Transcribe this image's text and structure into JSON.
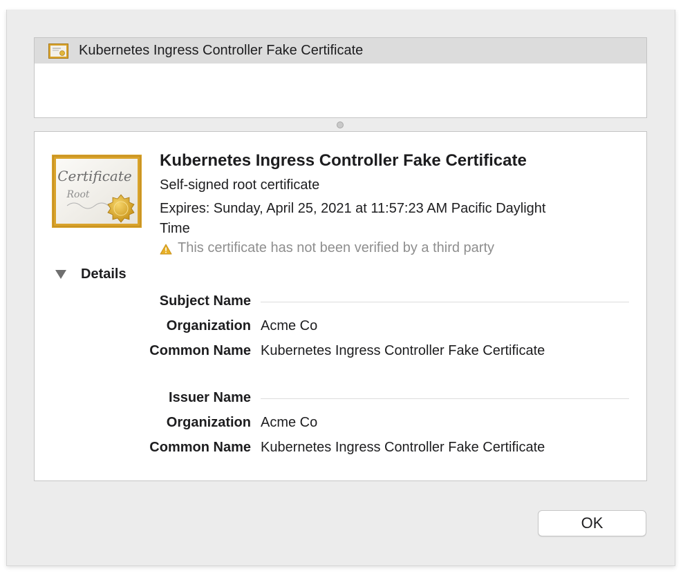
{
  "certificate_list": {
    "items": [
      {
        "icon": "certificate-icon",
        "label": "Kubernetes Ingress Controller Fake Certificate",
        "selected": true
      }
    ]
  },
  "certificate": {
    "icon": "certificate-root-icon",
    "title": "Kubernetes Ingress Controller Fake Certificate",
    "subtitle": "Self-signed root certificate",
    "expires": "Expires: Sunday, April 25, 2021 at 11:57:23 AM Pacific Daylight Time",
    "warning": "This certificate has not been verified by a third party",
    "warning_icon": "warning-icon",
    "icon_text": {
      "line1": "Certificate",
      "line2": "Root"
    }
  },
  "details": {
    "label": "Details",
    "expanded": true,
    "subject": {
      "heading": "Subject Name",
      "organization_label": "Organization",
      "organization_value": "Acme Co",
      "common_name_label": "Common Name",
      "common_name_value": "Kubernetes Ingress Controller Fake Certificate"
    },
    "issuer": {
      "heading": "Issuer Name",
      "organization_label": "Organization",
      "organization_value": "Acme Co",
      "common_name_label": "Common Name",
      "common_name_value": "Kubernetes Ingress Controller Fake Certificate"
    }
  },
  "buttons": {
    "ok_label": "OK"
  },
  "colors": {
    "certificate_frame": "#d9a32b",
    "warning": "#e8b027",
    "selected_row": "#dcdcdc"
  }
}
